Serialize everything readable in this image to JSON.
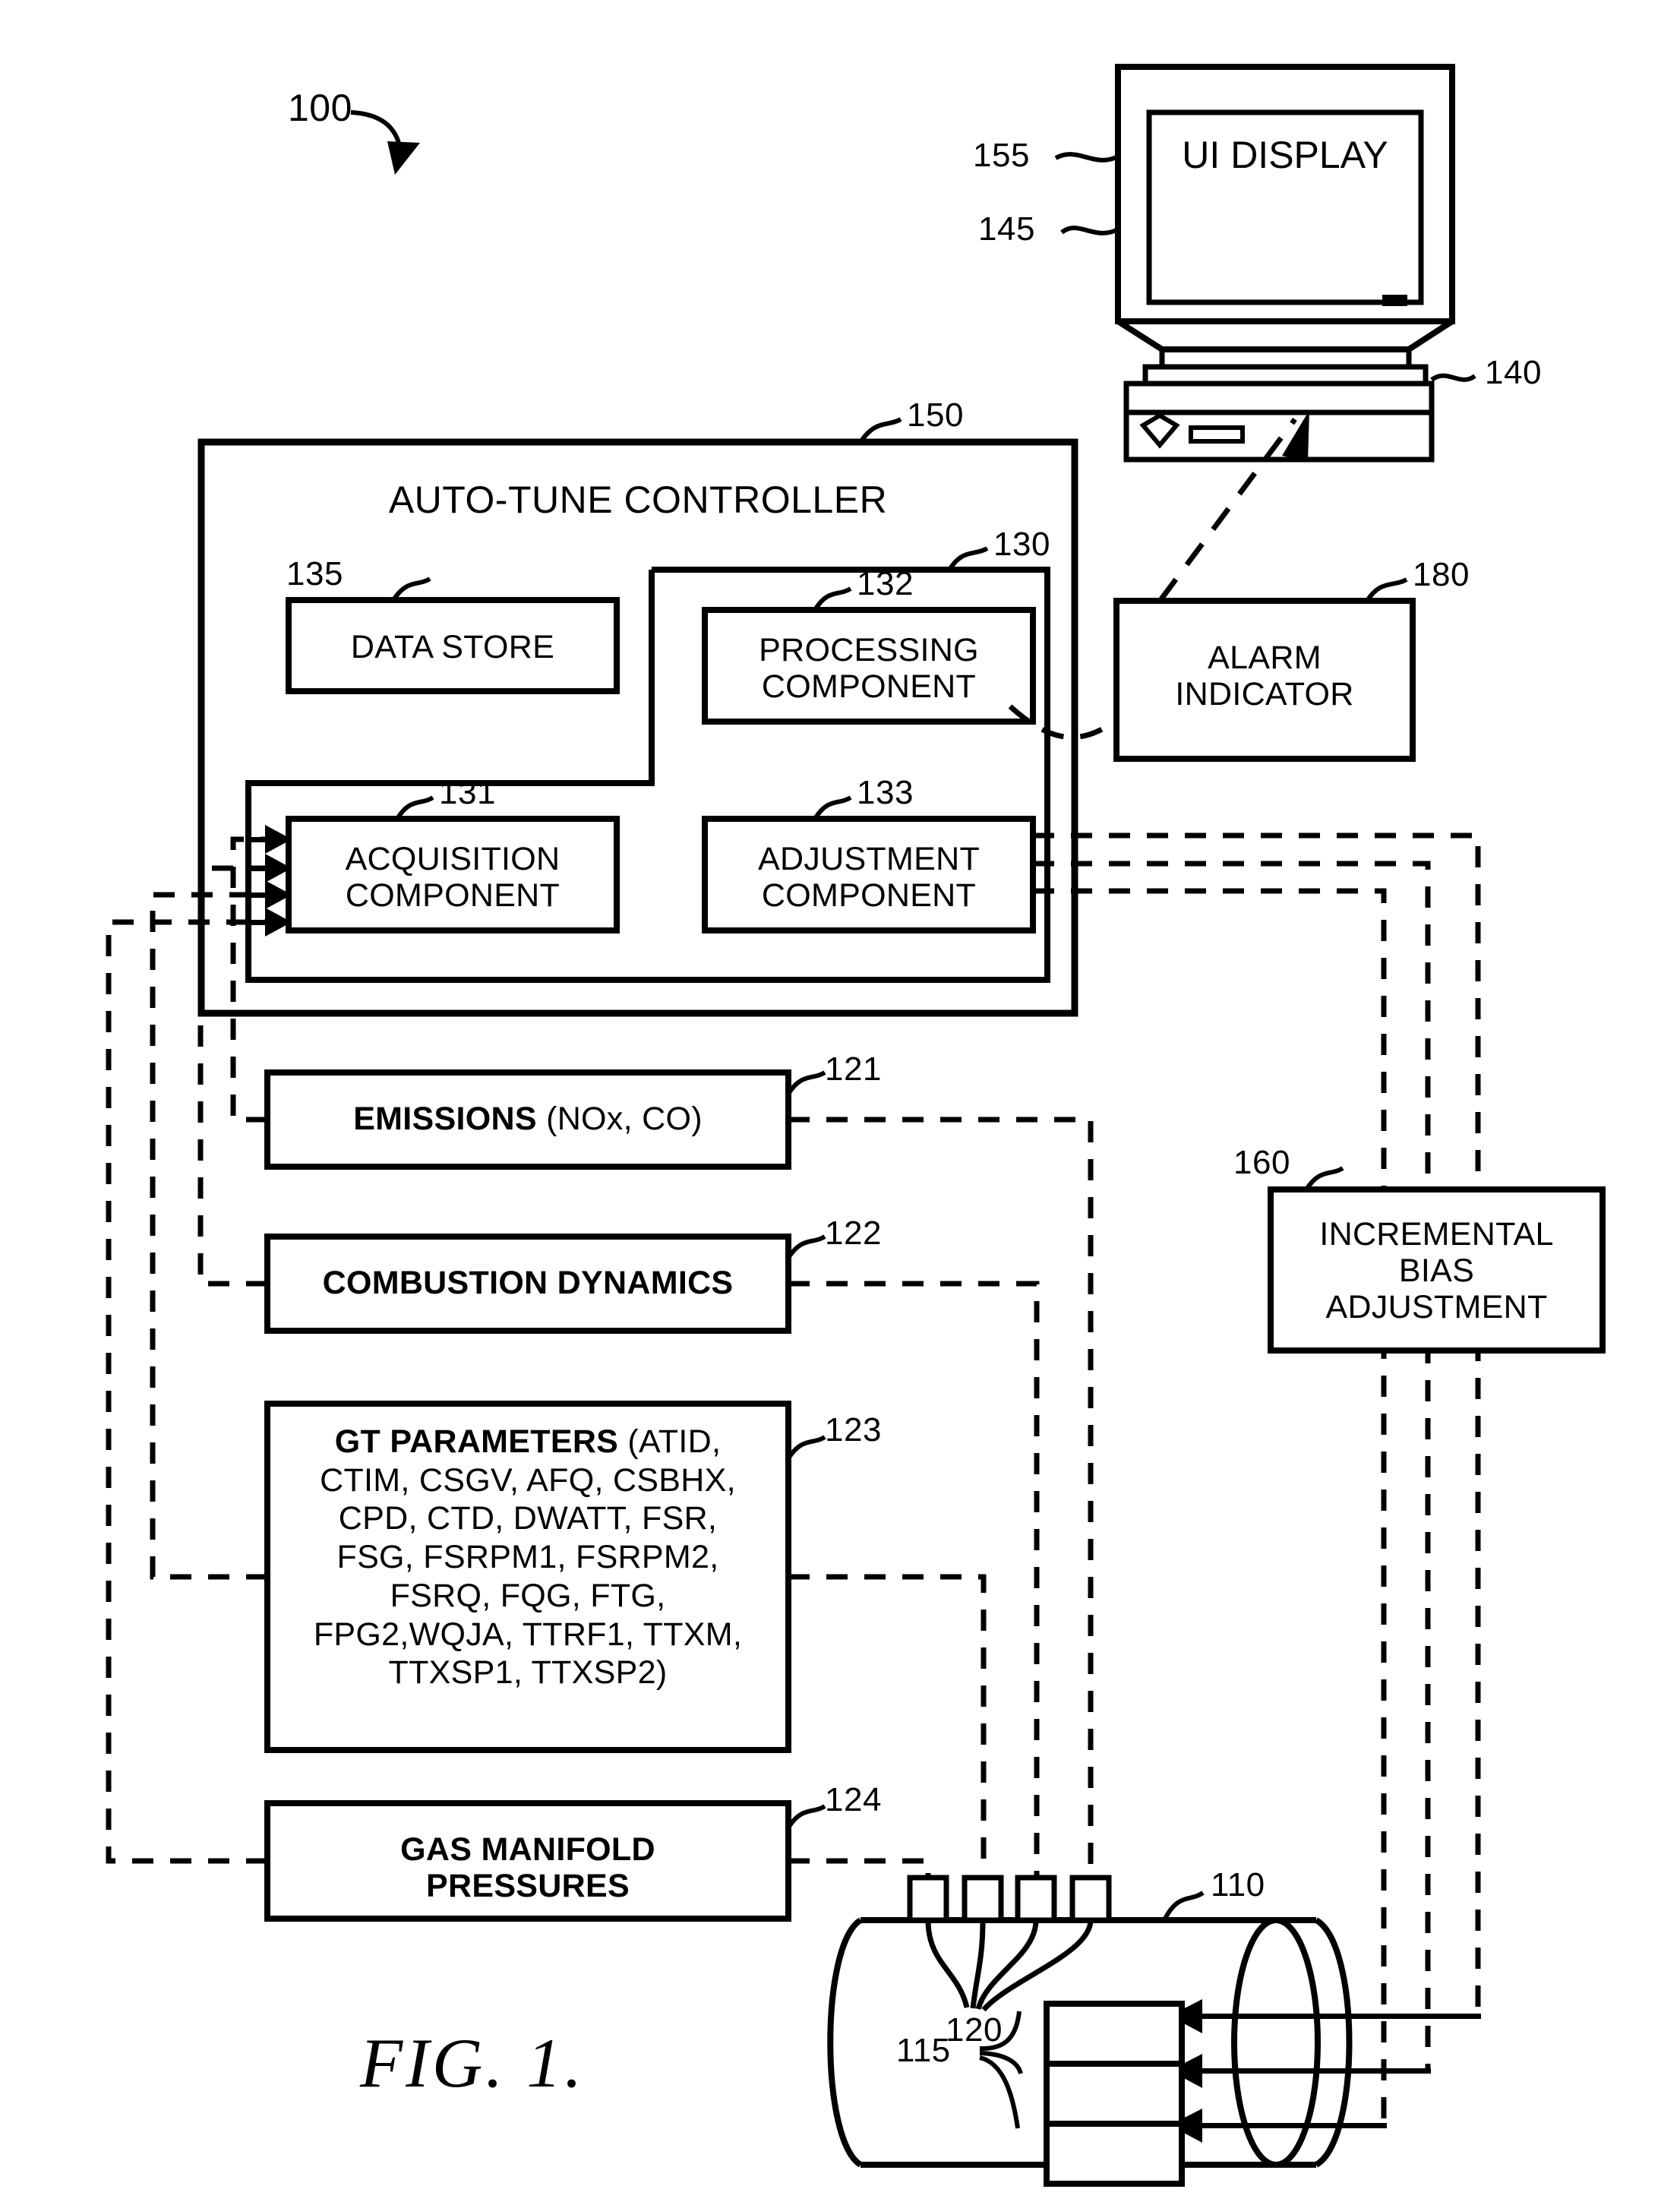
{
  "figure": {
    "caption": "FIG. 1.",
    "system_ref": "100"
  },
  "display": {
    "screen_label": "UI DISPLAY",
    "screen_ref": "155",
    "monitor_ref": "145",
    "computer_ref": "140"
  },
  "controller": {
    "title": "AUTO-TUNE CONTROLLER",
    "ref": "150",
    "inner_group_ref": "130",
    "blocks": [
      {
        "label": "DATA STORE",
        "ref": "135"
      },
      {
        "label_line1": "PROCESSING",
        "label_line2": "COMPONENT",
        "ref": "132"
      },
      {
        "label_line1": "ACQUISITION",
        "label_line2": "COMPONENT",
        "ref": "131"
      },
      {
        "label_line1": "ADJUSTMENT",
        "label_line2": "COMPONENT",
        "ref": "133"
      }
    ]
  },
  "alarm": {
    "label_line1": "ALARM",
    "label_line2": "INDICATOR",
    "ref": "180"
  },
  "bias": {
    "label_line1": "INCREMENTAL",
    "label_line2": "BIAS",
    "label_line3": "ADJUSTMENT",
    "ref": "160"
  },
  "inputs": [
    {
      "ref": "121",
      "bold": "EMISSIONS",
      "rest": " (NOx, CO)",
      "lines": [
        "EMISSIONS (NOx, CO)"
      ]
    },
    {
      "ref": "122",
      "bold": "COMBUSTION DYNAMICS",
      "rest": "",
      "lines": [
        "COMBUSTION DYNAMICS"
      ]
    },
    {
      "ref": "123",
      "bold": "GT PARAMETERS",
      "rest": " (ATID,",
      "lines": [
        "GT PARAMETERS (ATID,",
        "CTIM, CSGV, AFQ, CSBHX,",
        "CPD, CTD, DWATT, FSR,",
        "FSG, FSRPM1, FSRPM2,",
        "FSRQ, FQG, FTG,",
        "FPG2,WQJA, TTRF1, TTXM,",
        "TTXSP1, TTXSP2)"
      ],
      "continuation": [
        "CTIM, CSGV, AFQ, CSBHX,",
        "CPD, CTD, DWATT, FSR,",
        "FSG, FSRPM1, FSRPM2,",
        "FSRQ, FQG, FTG,",
        "FPG2,WQJA, TTRF1, TTXM,",
        "TTXSP1, TTXSP2)"
      ]
    },
    {
      "ref": "124",
      "bold": "GAS MANIFOLD",
      "rest": "",
      "lines": [
        "GAS MANIFOLD",
        "PRESSURES"
      ],
      "line2": "PRESSURES"
    }
  ],
  "turbine": {
    "ref": "110",
    "sensors_ref": "120",
    "fuel_circuits_ref": "115"
  },
  "colors": {
    "stroke": "#000000",
    "background": "#ffffff"
  }
}
